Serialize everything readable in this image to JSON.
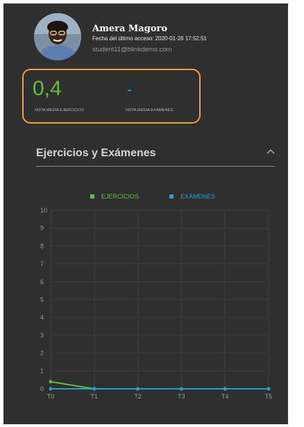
{
  "profile": {
    "name": "Amera Magoro",
    "last_access": "Fecha del último acceso: 2020-01-26 17:52:51",
    "email": "student11@blinkdemo.com"
  },
  "stats": {
    "ejercicios": {
      "value": "0,4",
      "label": "NOTA MEDIA EJERCICIOS"
    },
    "examenes": {
      "value": "-",
      "label": "NOTA MEDIA EXÁMENES"
    }
  },
  "section": {
    "title": "Ejercicios y Exámenes",
    "collapse_icon": "chevron-up-icon"
  },
  "colors": {
    "panel_bg": "#2f2f2f",
    "accent_orange": "#f0a23a",
    "ejercicios": "#5cc33b",
    "examenes": "#2b9fc7"
  },
  "chart_data": {
    "type": "line",
    "x": [
      "T0",
      "T1",
      "T2",
      "T3",
      "T4",
      "T5"
    ],
    "ylim": [
      0,
      10
    ],
    "yticks": [
      "0",
      "1",
      "2",
      "3",
      "4",
      "5",
      "6",
      "7",
      "8",
      "9",
      "10"
    ],
    "grid": true,
    "legend_position": "top-center",
    "series": [
      {
        "name": "EJERCICIOS",
        "color": "#5cc33b",
        "values": [
          0.4,
          0,
          0,
          0,
          0,
          0
        ]
      },
      {
        "name": "EXÁMENES",
        "color": "#2b9fc7",
        "values": [
          0,
          0,
          0,
          0,
          0,
          0
        ]
      }
    ]
  }
}
